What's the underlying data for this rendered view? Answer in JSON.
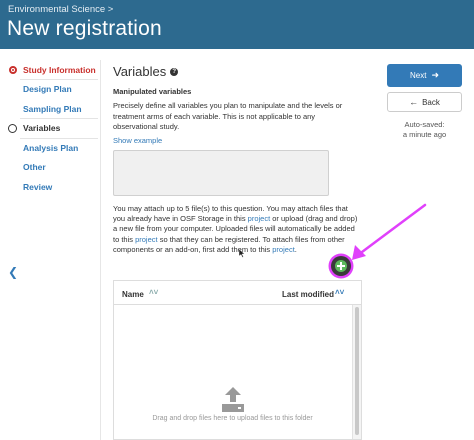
{
  "header": {
    "breadcrumb": "Environmental Science >",
    "title": "New registration",
    "background": "#2d6a8f"
  },
  "sidebar": {
    "steps": [
      {
        "label": "Study Information",
        "state": "done"
      },
      {
        "label": "Design Plan",
        "state": "pending"
      },
      {
        "label": "Sampling Plan",
        "state": "pending"
      },
      {
        "label": "Variables",
        "state": "current"
      },
      {
        "label": "Analysis Plan",
        "state": "pending"
      },
      {
        "label": "Other",
        "state": "pending"
      },
      {
        "label": "Review",
        "state": "pending"
      }
    ],
    "collapse_icon": "chevron-left-icon"
  },
  "main": {
    "section_title": "Variables",
    "help_icon": "question-icon",
    "field_label": "Manipulated variables",
    "field_description": "Precisely define all variables you plan to manipulate and the levels or treatment arms of each variable. This is not applicable to any observational study.",
    "show_example": "Show example",
    "textarea_value": "",
    "attach_text": {
      "part1": "You may attach up to 5 file(s) to this question. You may attach files that you already have in OSF Storage in this ",
      "link1": "project",
      "part2": " or upload (drag and drop) a new file from your computer. Uploaded files will automatically be added to this ",
      "link2": "project",
      "part3": " so that they can be registered. To attach files from other components or an add-on, first add them to this ",
      "link3": "project",
      "part4": "."
    }
  },
  "files": {
    "col_name": "Name",
    "col_modified": "Last modified",
    "drop_text": "Drag and drop files here to upload files to this folder",
    "add_icon": "plus-circle-icon",
    "upload_icon": "upload-icon"
  },
  "actions": {
    "next_label": "Next",
    "back_label": "Back",
    "autosave_line1": "Auto-saved:",
    "autosave_line2": "a minute ago",
    "accent": "#337ab7"
  },
  "annotation": {
    "color": "#e040fb"
  }
}
